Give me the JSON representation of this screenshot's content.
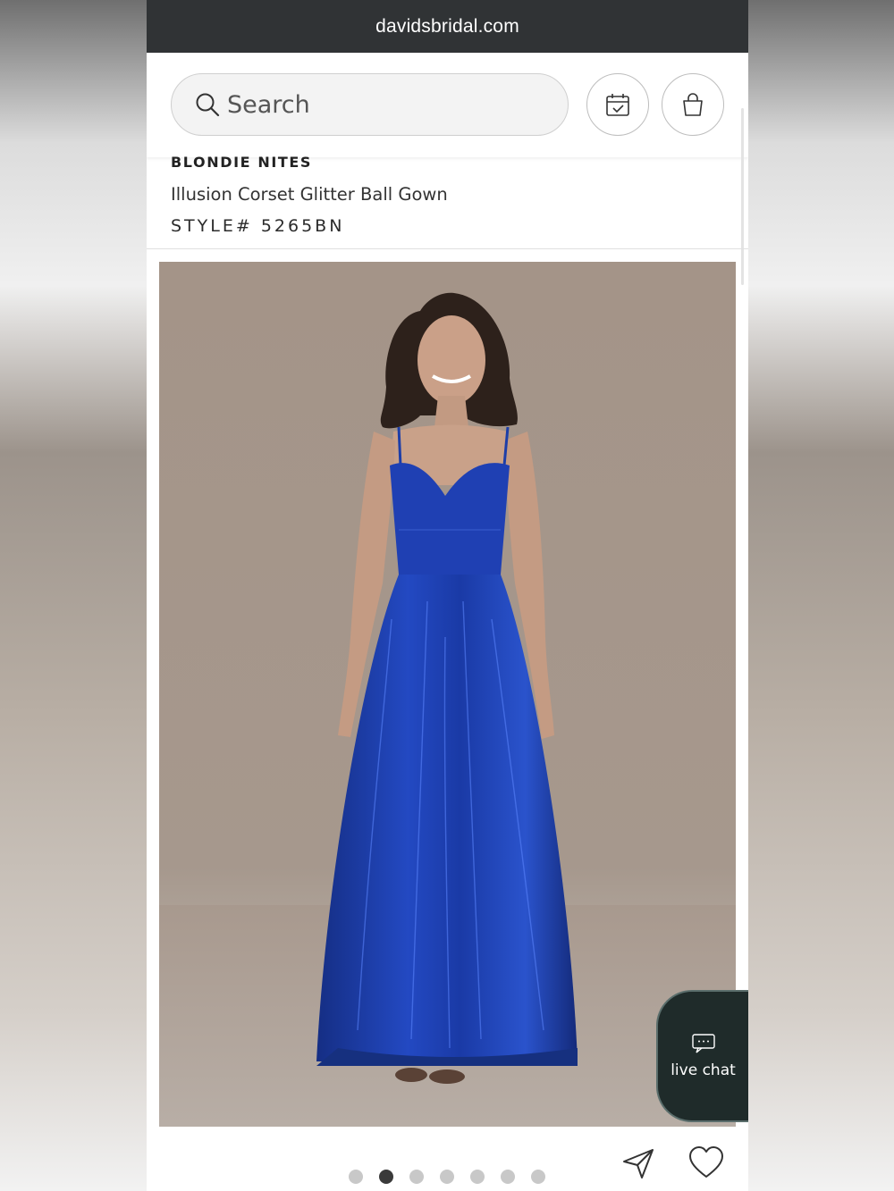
{
  "browser": {
    "url": "davidsbridal.com"
  },
  "header": {
    "search_placeholder": "Search",
    "icons": [
      "search-icon",
      "calendar-check-icon",
      "shopping-bag-icon"
    ]
  },
  "product": {
    "brand": "BLONDIE NITES",
    "name": "Illusion Corset Glitter Ball Gown",
    "style": "STYLE# 5265BN",
    "image_dress_color": "#1d3ea8"
  },
  "live_chat": {
    "label": "live chat"
  },
  "carousel": {
    "total": 7,
    "active_index": 1
  },
  "actions": {
    "icons": [
      "share-icon",
      "heart-icon"
    ]
  },
  "colors": {
    "url_bar": "#303335",
    "chat_bg": "#1f2b2a"
  }
}
